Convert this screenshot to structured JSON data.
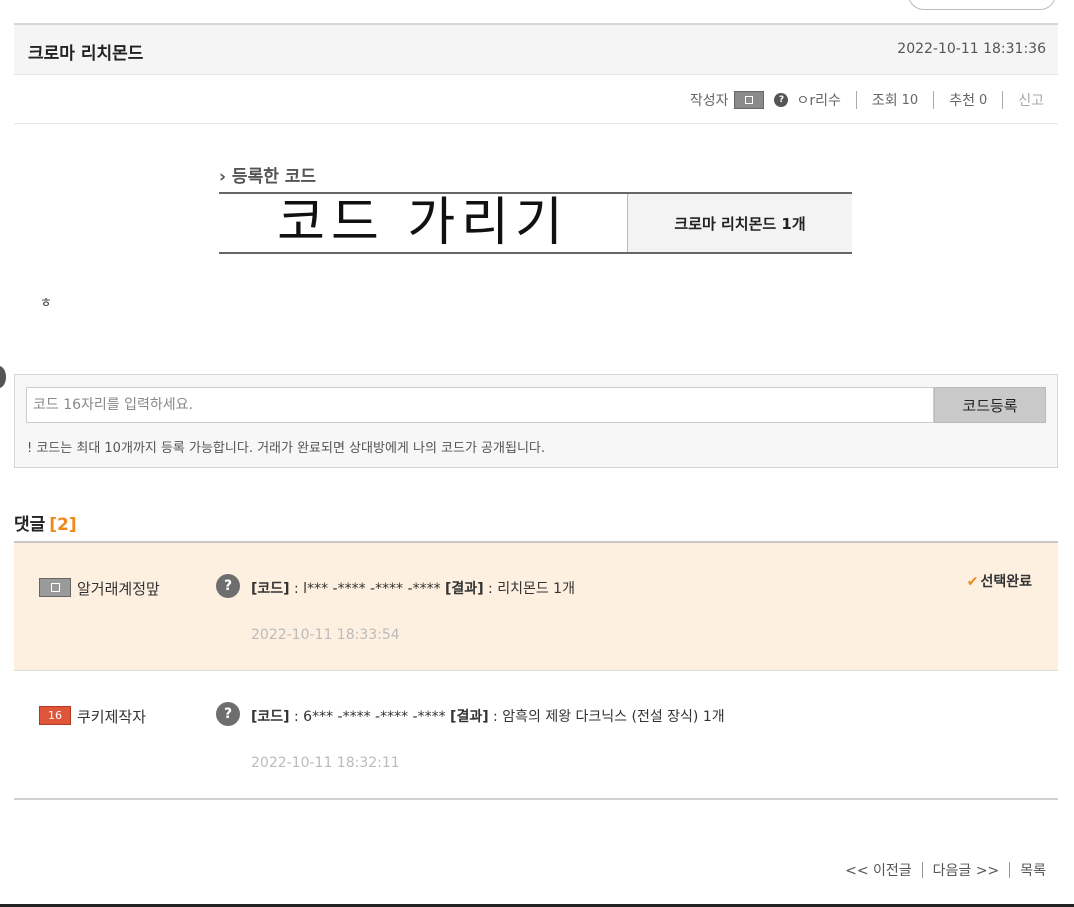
{
  "post": {
    "title": "크로마 리치몬드",
    "date": "2022-10-11 18:31:36",
    "meta": {
      "author_label": "작성자",
      "author_name": "ㅇr리수",
      "views_label": "조회",
      "views": "10",
      "likes_label": "추천",
      "likes": "0",
      "report": "신고"
    }
  },
  "code_section": {
    "label": "› 등록한 코드",
    "hidden_code_text": "코드 가리기",
    "reward": "크로마 리치몬드 1개"
  },
  "body_text": "ㅎ",
  "code_form": {
    "placeholder": "코드 16자리를 입력하세요.",
    "submit_label": "코드등록",
    "notice": "! 코드는 최대 10개까지 등록 가능합니다. 거래가 완료되면 상대방에게 나의 코드가 공개됩니다."
  },
  "comments": {
    "title": "댓글",
    "count": "[2]",
    "items": [
      {
        "level": "",
        "user": "알거래계정맢",
        "code_label": "[코드]",
        "code": " : l*** -**** -**** -**** ",
        "result_label": "[결과]",
        "result": " : 리치몬드 1개",
        "date": "2022-10-11 18:33:54",
        "selected_label": "선택완료"
      },
      {
        "level": "16",
        "user": "쿠키제작자",
        "code_label": "[코드]",
        "code": " : 6*** -**** -**** -**** ",
        "result_label": "[결과]",
        "result": " : 암흑의 제왕 다크닉스 (전설 장식) 1개",
        "date": "2022-10-11 18:32:11"
      }
    ]
  },
  "nav": {
    "prev": "<< 이전글",
    "next": "다음글 >>",
    "list": "목록"
  },
  "colors": {
    "accent": "#f0881a",
    "selected_bg": "#fdf0e1",
    "level_red": "#e0553a"
  }
}
